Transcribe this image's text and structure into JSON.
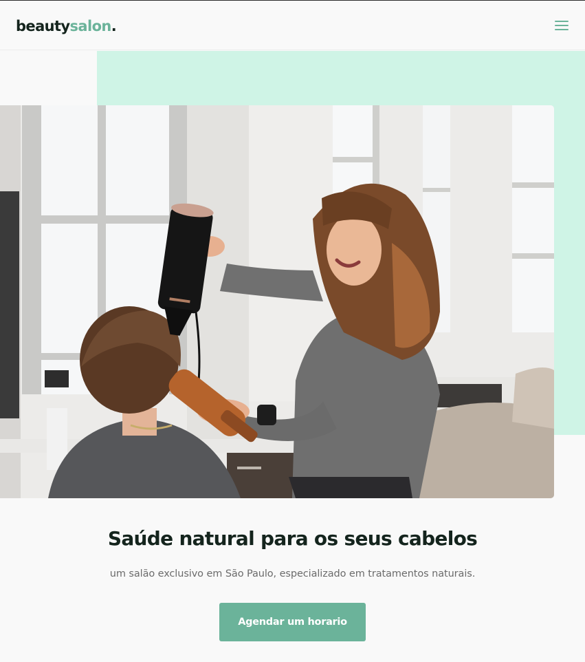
{
  "header": {
    "logo": {
      "part1": "beauty",
      "part2": "salon",
      "part3": "."
    },
    "menu_icon": "hamburger-menu-icon"
  },
  "hero": {
    "photo_icon": "salon-photo",
    "title": "Saúde natural para os seus cabelos",
    "subtitle": "um salão exclusivo em São Paulo, especializado em tratamentos naturais.",
    "cta_label": "Agendar um horario"
  },
  "colors": {
    "accent": "#6bb39a",
    "mint_background": "#cff4e6",
    "text_dark": "#14241d",
    "text_muted": "#6b6b6b",
    "page_background": "#f9f9f9"
  }
}
